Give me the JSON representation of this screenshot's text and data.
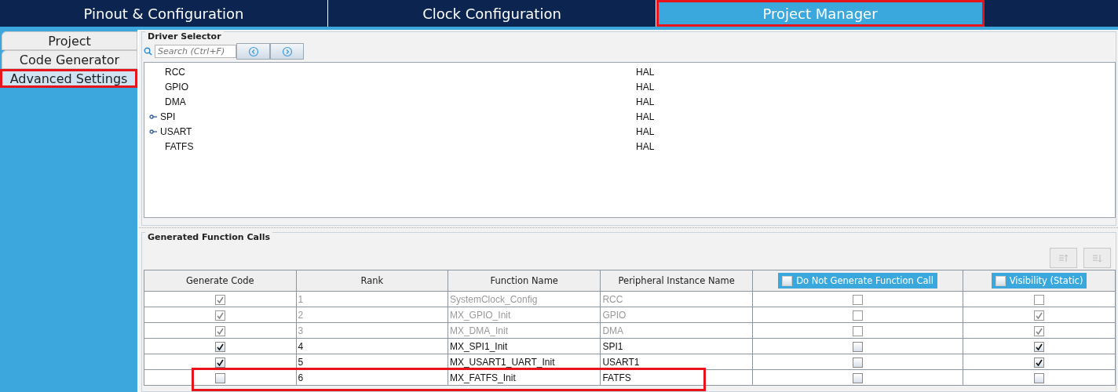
{
  "top_tabs": [
    {
      "label": "Pinout & Configuration",
      "selected": false,
      "highlighted": false
    },
    {
      "label": "Clock Configuration",
      "selected": false,
      "highlighted": false
    },
    {
      "label": "Project Manager",
      "selected": true,
      "highlighted": true
    }
  ],
  "side_tabs": [
    {
      "label": "Project",
      "selected": false,
      "highlighted": false
    },
    {
      "label": "Code Generator",
      "selected": false,
      "highlighted": false
    },
    {
      "label": "Advanced Settings",
      "selected": true,
      "highlighted": true
    }
  ],
  "driver_selector": {
    "title": "Driver Selector",
    "search": {
      "placeholder": "Search (Ctrl+F)"
    },
    "rows": [
      {
        "name": "RCC",
        "driver": "HAL",
        "expandable": false
      },
      {
        "name": "GPIO",
        "driver": "HAL",
        "expandable": false
      },
      {
        "name": "DMA",
        "driver": "HAL",
        "expandable": false
      },
      {
        "name": "SPI",
        "driver": "HAL",
        "expandable": true
      },
      {
        "name": "USART",
        "driver": "HAL",
        "expandable": true
      },
      {
        "name": "FATFS",
        "driver": "HAL",
        "expandable": false
      }
    ]
  },
  "function_calls": {
    "title": "Generated Function Calls",
    "columns": [
      {
        "label": "Generate Code",
        "kind": "plain"
      },
      {
        "label": "Rank",
        "kind": "plain"
      },
      {
        "label": "Function Name",
        "kind": "plain"
      },
      {
        "label": "Peripheral Instance Name",
        "kind": "plain"
      },
      {
        "label": "Do Not Generate Function Call",
        "kind": "checkbox",
        "checked": false
      },
      {
        "label": "Visibility (Static)",
        "kind": "checkbox",
        "checked": false
      }
    ],
    "rows": [
      {
        "generate": true,
        "rank": "1",
        "function": "SystemClock_Config",
        "instance": "RCC",
        "do_not_generate": false,
        "visibility": false,
        "disabled": true,
        "highlighted": false
      },
      {
        "generate": true,
        "rank": "2",
        "function": "MX_GPIO_Init",
        "instance": "GPIO",
        "do_not_generate": false,
        "visibility": true,
        "disabled": true,
        "highlighted": false
      },
      {
        "generate": true,
        "rank": "3",
        "function": "MX_DMA_Init",
        "instance": "DMA",
        "do_not_generate": false,
        "visibility": true,
        "disabled": true,
        "highlighted": false
      },
      {
        "generate": true,
        "rank": "4",
        "function": "MX_SPI1_Init",
        "instance": "SPI1",
        "do_not_generate": false,
        "visibility": true,
        "disabled": false,
        "highlighted": false
      },
      {
        "generate": true,
        "rank": "5",
        "function": "MX_USART1_UART_Init",
        "instance": "USART1",
        "do_not_generate": false,
        "visibility": true,
        "disabled": false,
        "highlighted": false
      },
      {
        "generate": false,
        "rank": "6",
        "function": "MX_FATFS_Init",
        "instance": "FATFS",
        "do_not_generate": false,
        "visibility": false,
        "disabled": false,
        "highlighted": true
      }
    ]
  }
}
